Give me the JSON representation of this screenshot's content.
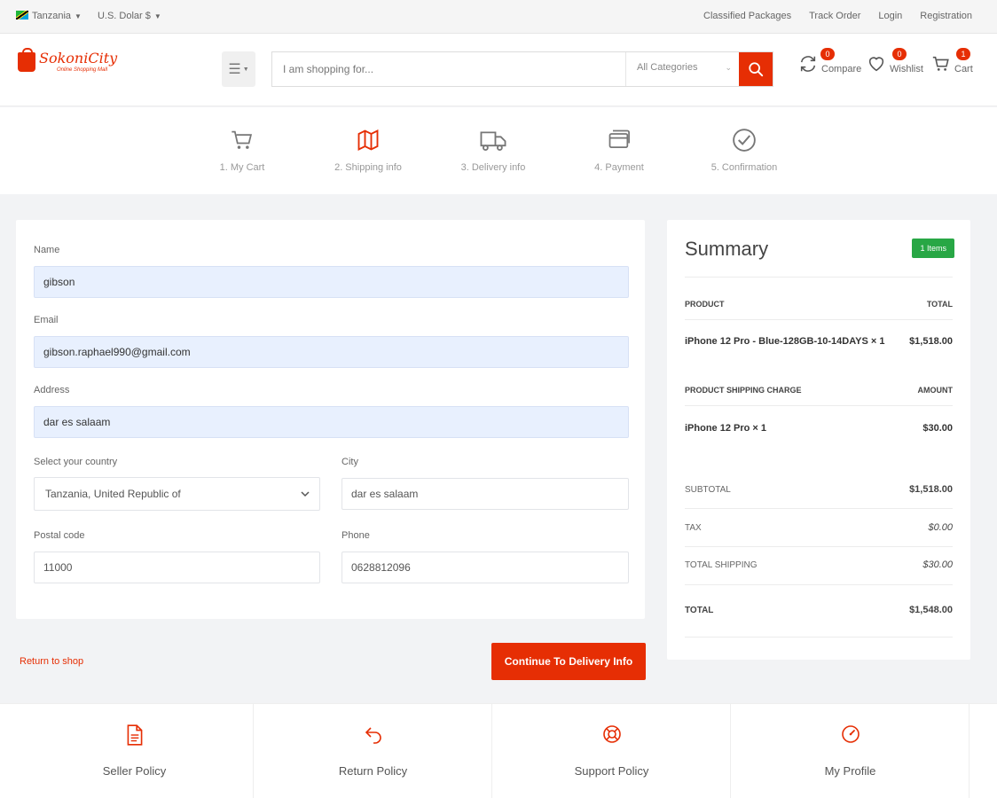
{
  "topbar": {
    "country": "Tanzania",
    "currency": "U.S. Dolar $",
    "links": [
      "Classified Packages",
      "Track Order",
      "Login",
      "Registration"
    ]
  },
  "header": {
    "logo_text": "SokoniCity",
    "logo_tagline": "Online Shopping Mall",
    "search_placeholder": "I am shopping for...",
    "category": "All Categories",
    "compare_label": "Compare",
    "compare_count": "0",
    "wishlist_label": "Wishlist",
    "wishlist_count": "0",
    "cart_label": "Cart",
    "cart_count": "1"
  },
  "steps": [
    {
      "label": "1. My Cart",
      "icon": "cart-icon",
      "active": false
    },
    {
      "label": "2. Shipping info",
      "icon": "map-icon",
      "active": true
    },
    {
      "label": "3. Delivery info",
      "icon": "truck-icon",
      "active": false
    },
    {
      "label": "4. Payment",
      "icon": "card-icon",
      "active": false
    },
    {
      "label": "5. Confirmation",
      "icon": "check-circle-icon",
      "active": false
    }
  ],
  "form": {
    "name_label": "Name",
    "name_value": "gibson",
    "email_label": "Email",
    "email_value": "gibson.raphael990@gmail.com",
    "address_label": "Address",
    "address_value": "dar es salaam",
    "country_label": "Select your country",
    "country_value": "Tanzania, United Republic of",
    "city_label": "City",
    "city_value": "dar es salaam",
    "postal_label": "Postal code",
    "postal_value": "11000",
    "phone_label": "Phone",
    "phone_value": "0628812096"
  },
  "actions": {
    "return_label": "Return to shop",
    "continue_label": "Continue To Delivery Info"
  },
  "summary": {
    "title": "Summary",
    "items_badge": "1 Items",
    "product_header": "PRODUCT",
    "total_header": "TOTAL",
    "product_name": "iPhone 12 Pro - Blue-128GB-10-14DAYS × 1",
    "product_total": "$1,518.00",
    "shipping_header": "PRODUCT SHIPPING CHARGE",
    "amount_header": "AMOUNT",
    "shipping_product": "iPhone 12 Pro × 1",
    "shipping_amount": "$30.00",
    "subtotal_label": "SUBTOTAL",
    "subtotal_value": "$1,518.00",
    "tax_label": "TAX",
    "tax_value": "$0.00",
    "total_shipping_label": "TOTAL SHIPPING",
    "total_shipping_value": "$30.00",
    "total_label": "TOTAL",
    "total_value": "$1,548.00"
  },
  "policies": [
    "Seller Policy",
    "Return Policy",
    "Support Policy",
    "My Profile"
  ],
  "colors": {
    "accent": "#e62e04",
    "badge_green": "#28a745",
    "filled_input": "#e8f0fe"
  }
}
